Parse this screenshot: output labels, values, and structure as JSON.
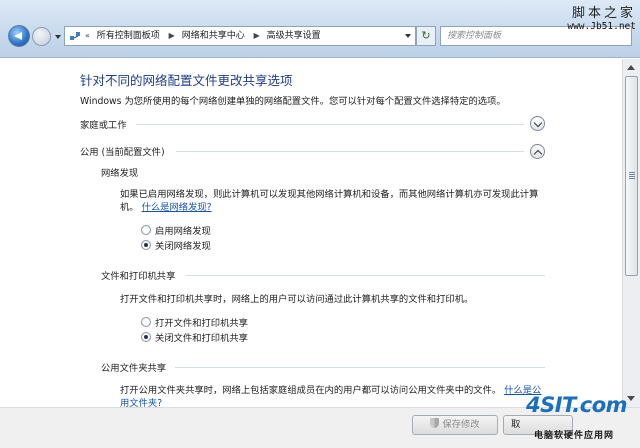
{
  "address_bar": {
    "breadcrumbs": [
      "所有控制面板项",
      "网络和共享中心",
      "高级共享设置"
    ],
    "search_placeholder": "搜索控制面板"
  },
  "watermark": {
    "top_line1": "脚本之家",
    "top_line2": "www.Jb51.net",
    "logo_brand": "4SIT.com",
    "logo_sub": "电脑软硬件应用网"
  },
  "content": {
    "title": "针对不同的网络配置文件更改共享选项",
    "description": "Windows 为您所使用的每个网络创建单独的网络配置文件。您可以针对每个配置文件选择特定的选项。",
    "profiles": [
      {
        "label": "家庭或工作",
        "expanded": false
      },
      {
        "label": "公用 (当前配置文件)",
        "expanded": true
      }
    ],
    "network_discovery": {
      "heading": "网络发现",
      "text": "如果已启用网络发现，则此计算机可以发现其他网络计算机和设备，而其他网络计算机亦可发现此计算机。",
      "link": "什么是网络发现?",
      "options": [
        {
          "label": "启用网络发现",
          "selected": false
        },
        {
          "label": "关闭网络发现",
          "selected": true
        }
      ]
    },
    "file_printer_sharing": {
      "heading": "文件和打印机共享",
      "text": "打开文件和打印机共享时，网络上的用户可以访问通过此计算机共享的文件和打印机。",
      "options": [
        {
          "label": "打开文件和打印机共享",
          "selected": false
        },
        {
          "label": "关闭文件和打印机共享",
          "selected": true
        }
      ]
    },
    "public_folder_sharing": {
      "heading": "公用文件夹共享",
      "text": "打开公用文件夹共享时，网络上包括家庭组成员在内的用户都可以访问公用文件夹中的文件。",
      "link": "什么是公用文件夹?"
    }
  },
  "footer": {
    "save_label": "保存修改",
    "cancel_label": "取"
  }
}
